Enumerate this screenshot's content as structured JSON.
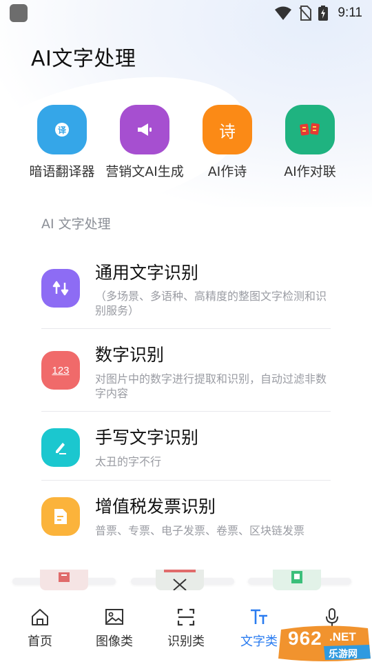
{
  "status_bar": {
    "time": "9:11",
    "icons": [
      "app-icon",
      "wifi-icon",
      "no-sim-icon",
      "battery-charging-icon"
    ]
  },
  "header": {
    "title": "AI文字处理"
  },
  "quick_actions": [
    {
      "label": "暗语翻译器",
      "icon": "translate-icon",
      "glyph": "译",
      "color": "#35a6e8"
    },
    {
      "label": "营销文AI生成",
      "icon": "megaphone-icon",
      "color": "#a64fd0"
    },
    {
      "label": "AI作诗",
      "icon": "poem-icon",
      "glyph": "诗",
      "color": "#fb8a16"
    },
    {
      "label": "AI作对联",
      "icon": "couplet-icon",
      "color": "#1fb380"
    }
  ],
  "section": {
    "label": "AI 文字处理"
  },
  "list_items": [
    {
      "title": "通用文字识别",
      "desc": "（多场景、多语种、高精度的整图文字检测和识别服务）",
      "icon": "text-recognition-icon",
      "color": "#8d6cf4"
    },
    {
      "title": "数字识别",
      "desc": "对图片中的数字进行提取和识别，自动过滤非数字内容",
      "icon": "number-recognition-icon",
      "glyph": "123",
      "color": "#f06a6a"
    },
    {
      "title": "手写文字识别",
      "desc": "太丑的字不行",
      "icon": "handwriting-icon",
      "color": "#1bc7cf"
    },
    {
      "title": "增值税发票识别",
      "desc": "普票、专票、电子发票、卷票、区块链发票",
      "icon": "invoice-icon",
      "color": "#fbb33b"
    }
  ],
  "tab_bar": {
    "tabs": [
      {
        "label": "首页",
        "icon": "home-icon",
        "active": false
      },
      {
        "label": "图像类",
        "icon": "image-icon",
        "active": false
      },
      {
        "label": "识别类",
        "icon": "scan-icon",
        "active": false
      },
      {
        "label": "文字类",
        "icon": "text-icon",
        "active": true
      },
      {
        "label": "",
        "icon": "microphone-icon",
        "active": false
      }
    ],
    "active_color": "#2a7cf0"
  },
  "watermark": {
    "number": "962",
    "suffix": ".NET",
    "site": "乐游网"
  }
}
